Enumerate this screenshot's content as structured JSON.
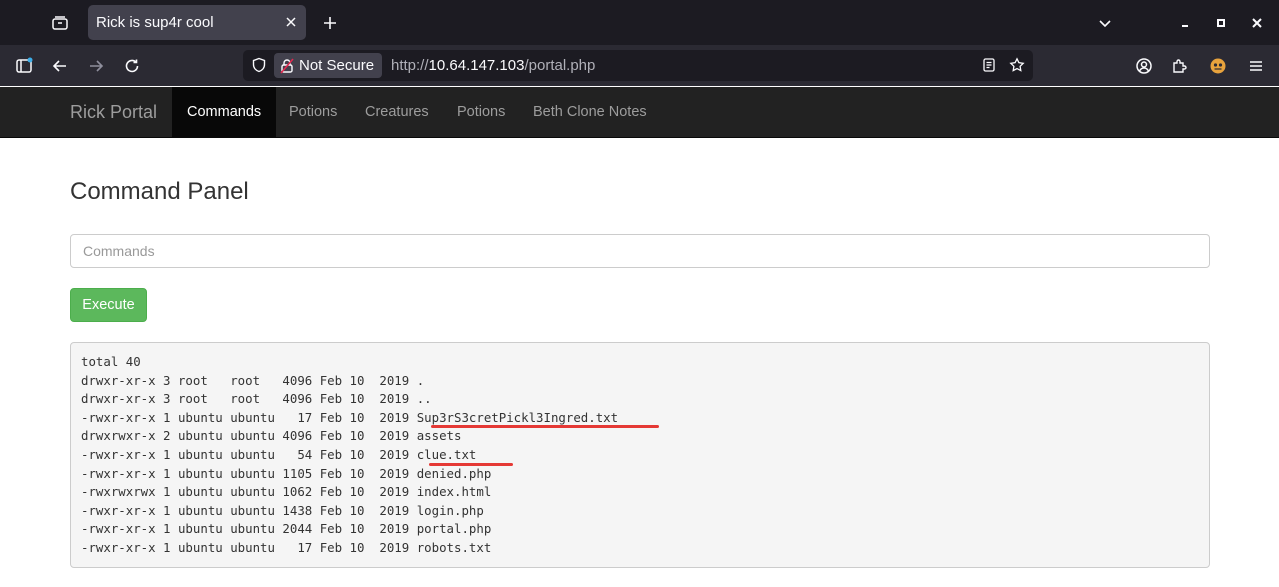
{
  "browser": {
    "tab": {
      "title": "Rick is sup4r cool"
    },
    "url": {
      "security_label": "Not Secure",
      "prefix": "http://",
      "host": "10.64.147.103",
      "path": "/portal.php"
    },
    "icons": [
      "tab-list-icon",
      "close-icon",
      "plus-icon",
      "chevron-down-icon",
      "minimize-icon",
      "maximize-icon",
      "window-close-icon",
      "sidebar-icon",
      "back-icon",
      "forward-icon",
      "reload-icon",
      "shield-icon",
      "lock-slash-icon",
      "reader-view-icon",
      "star-icon",
      "account-icon",
      "extensions-icon",
      "extension-icon",
      "menu-icon"
    ]
  },
  "site": {
    "brand": "Rick Portal",
    "nav": [
      {
        "label": "Commands",
        "active": true
      },
      {
        "label": "Potions",
        "active": false
      },
      {
        "label": "Creatures",
        "active": false
      },
      {
        "label": "Potions",
        "active": false
      },
      {
        "label": "Beth Clone Notes",
        "active": false
      }
    ]
  },
  "main": {
    "title": "Command Panel",
    "input": {
      "placeholder": "Commands",
      "value": ""
    },
    "execute_label": "Execute",
    "output_lines": [
      "total 40",
      "drwxr-xr-x 3 root   root   4096 Feb 10  2019 .",
      "drwxr-xr-x 3 root   root   4096 Feb 10  2019 ..",
      "-rwxr-xr-x 1 ubuntu ubuntu   17 Feb 10  2019 Sup3rS3cretPickl3Ingred.txt",
      "drwxrwxr-x 2 ubuntu ubuntu 4096 Feb 10  2019 assets",
      "-rwxr-xr-x 1 ubuntu ubuntu   54 Feb 10  2019 clue.txt",
      "-rwxr-xr-x 1 ubuntu ubuntu 1105 Feb 10  2019 denied.php",
      "-rwxrwxrwx 1 ubuntu ubuntu 1062 Feb 10  2019 index.html",
      "-rwxr-xr-x 1 ubuntu ubuntu 1438 Feb 10  2019 login.php",
      "-rwxr-xr-x 1 ubuntu ubuntu 2044 Feb 10  2019 portal.php",
      "-rwxr-xr-x 1 ubuntu ubuntu   17 Feb 10  2019 robots.txt"
    ],
    "highlighted_files": [
      "Sup3rS3cretPickl3Ingred.txt",
      "clue.txt"
    ],
    "annotation_color": "#e53935"
  }
}
